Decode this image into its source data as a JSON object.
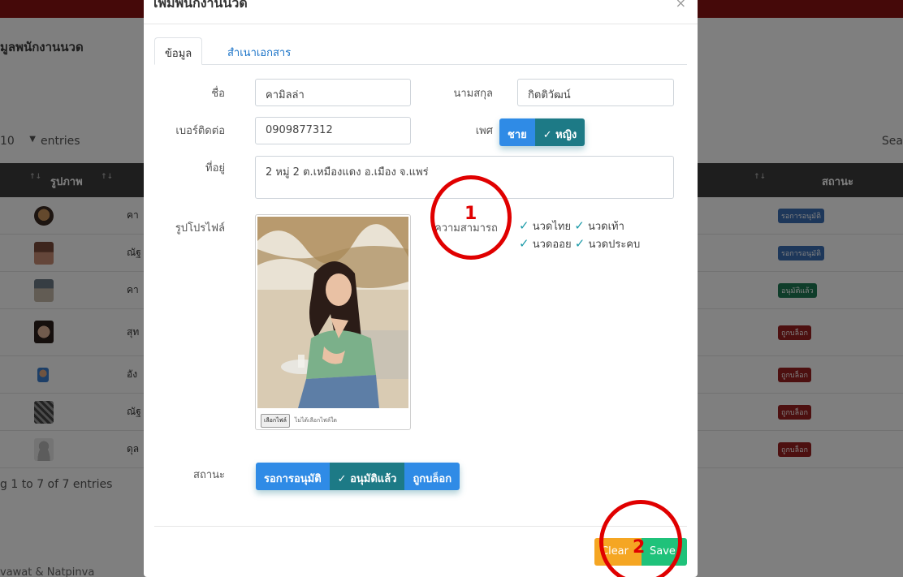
{
  "background": {
    "page_title": "มูลพนักงานนวด",
    "entries_num": "10",
    "entries_label": "entries",
    "search_label": "Sea",
    "table_headers": {
      "image": "รูปภาพ",
      "status": "สถานะ"
    },
    "rows": [
      {
        "name": "คา",
        "status": "รอการอนุมัติ",
        "status_color": "#3b6fb5"
      },
      {
        "name": "ณัฐ",
        "status": "รอการอนุมัติ",
        "status_color": "#3b6fb5"
      },
      {
        "name": "คา",
        "status": "อนุมัติแล้ว",
        "status_color": "#1f7a55"
      },
      {
        "name": "สุท",
        "status": "ถูกบล็อก",
        "status_color": "#9a2020"
      },
      {
        "name": "อัง",
        "status": "ถูกบล็อก",
        "status_color": "#9a2020"
      },
      {
        "name": "ณัฐ",
        "status": "ถูกบล็อก",
        "status_color": "#9a2020"
      },
      {
        "name": "ดุล",
        "status": "ถูกบล็อก",
        "status_color": "#9a2020"
      }
    ],
    "info_text": "g 1 to 7 of 7 entries",
    "footer_text": "vawat & Natpinva"
  },
  "modal": {
    "title": "เพิ่มพนักงานนวด",
    "close": "×",
    "tabs": {
      "info": "ข้อมูล",
      "documents": "สำเนาเอกสาร"
    },
    "first_name_label": "ชื่อ",
    "first_name_value": "คามิลล่า",
    "last_name_label": "นามสกุล",
    "last_name_value": "กิตติวัฒน์",
    "phone_label": "เบอร์ติดต่อ",
    "phone_value": "0909877312",
    "gender_label": "เพศ",
    "gender_male": "ชาย",
    "gender_female": "✓ หญิง",
    "address_label": "ที่อยู่",
    "address_value": "2 หมู่ 2 ต.เหมืองแดง อ.เมือง จ.แพร่",
    "profile_label": "รูปโปรไฟล์",
    "file_button": "เลือกไฟล์",
    "file_status": "ไม่ได้เลือกไฟล์ใด",
    "skills_label": "ความสามารถ",
    "skills": [
      "นวดไทย",
      "นวดเท้า",
      "นวดออย",
      "นวดประคบ"
    ],
    "status_label": "สถานะ",
    "status_pending": "รอการอนุมัติ",
    "status_approved": "✓ อนุมัติแล้ว",
    "status_blocked": "ถูกบล็อก",
    "clear_button": "Clear",
    "save_button": "Save"
  },
  "annotations": {
    "one": "1",
    "two": "2"
  },
  "colors": {
    "accent_blue": "#2f8be6",
    "accent_teal": "#1d7a86",
    "clear": "#f5a623",
    "save": "#1fc27a",
    "annotation": "#e00000"
  }
}
